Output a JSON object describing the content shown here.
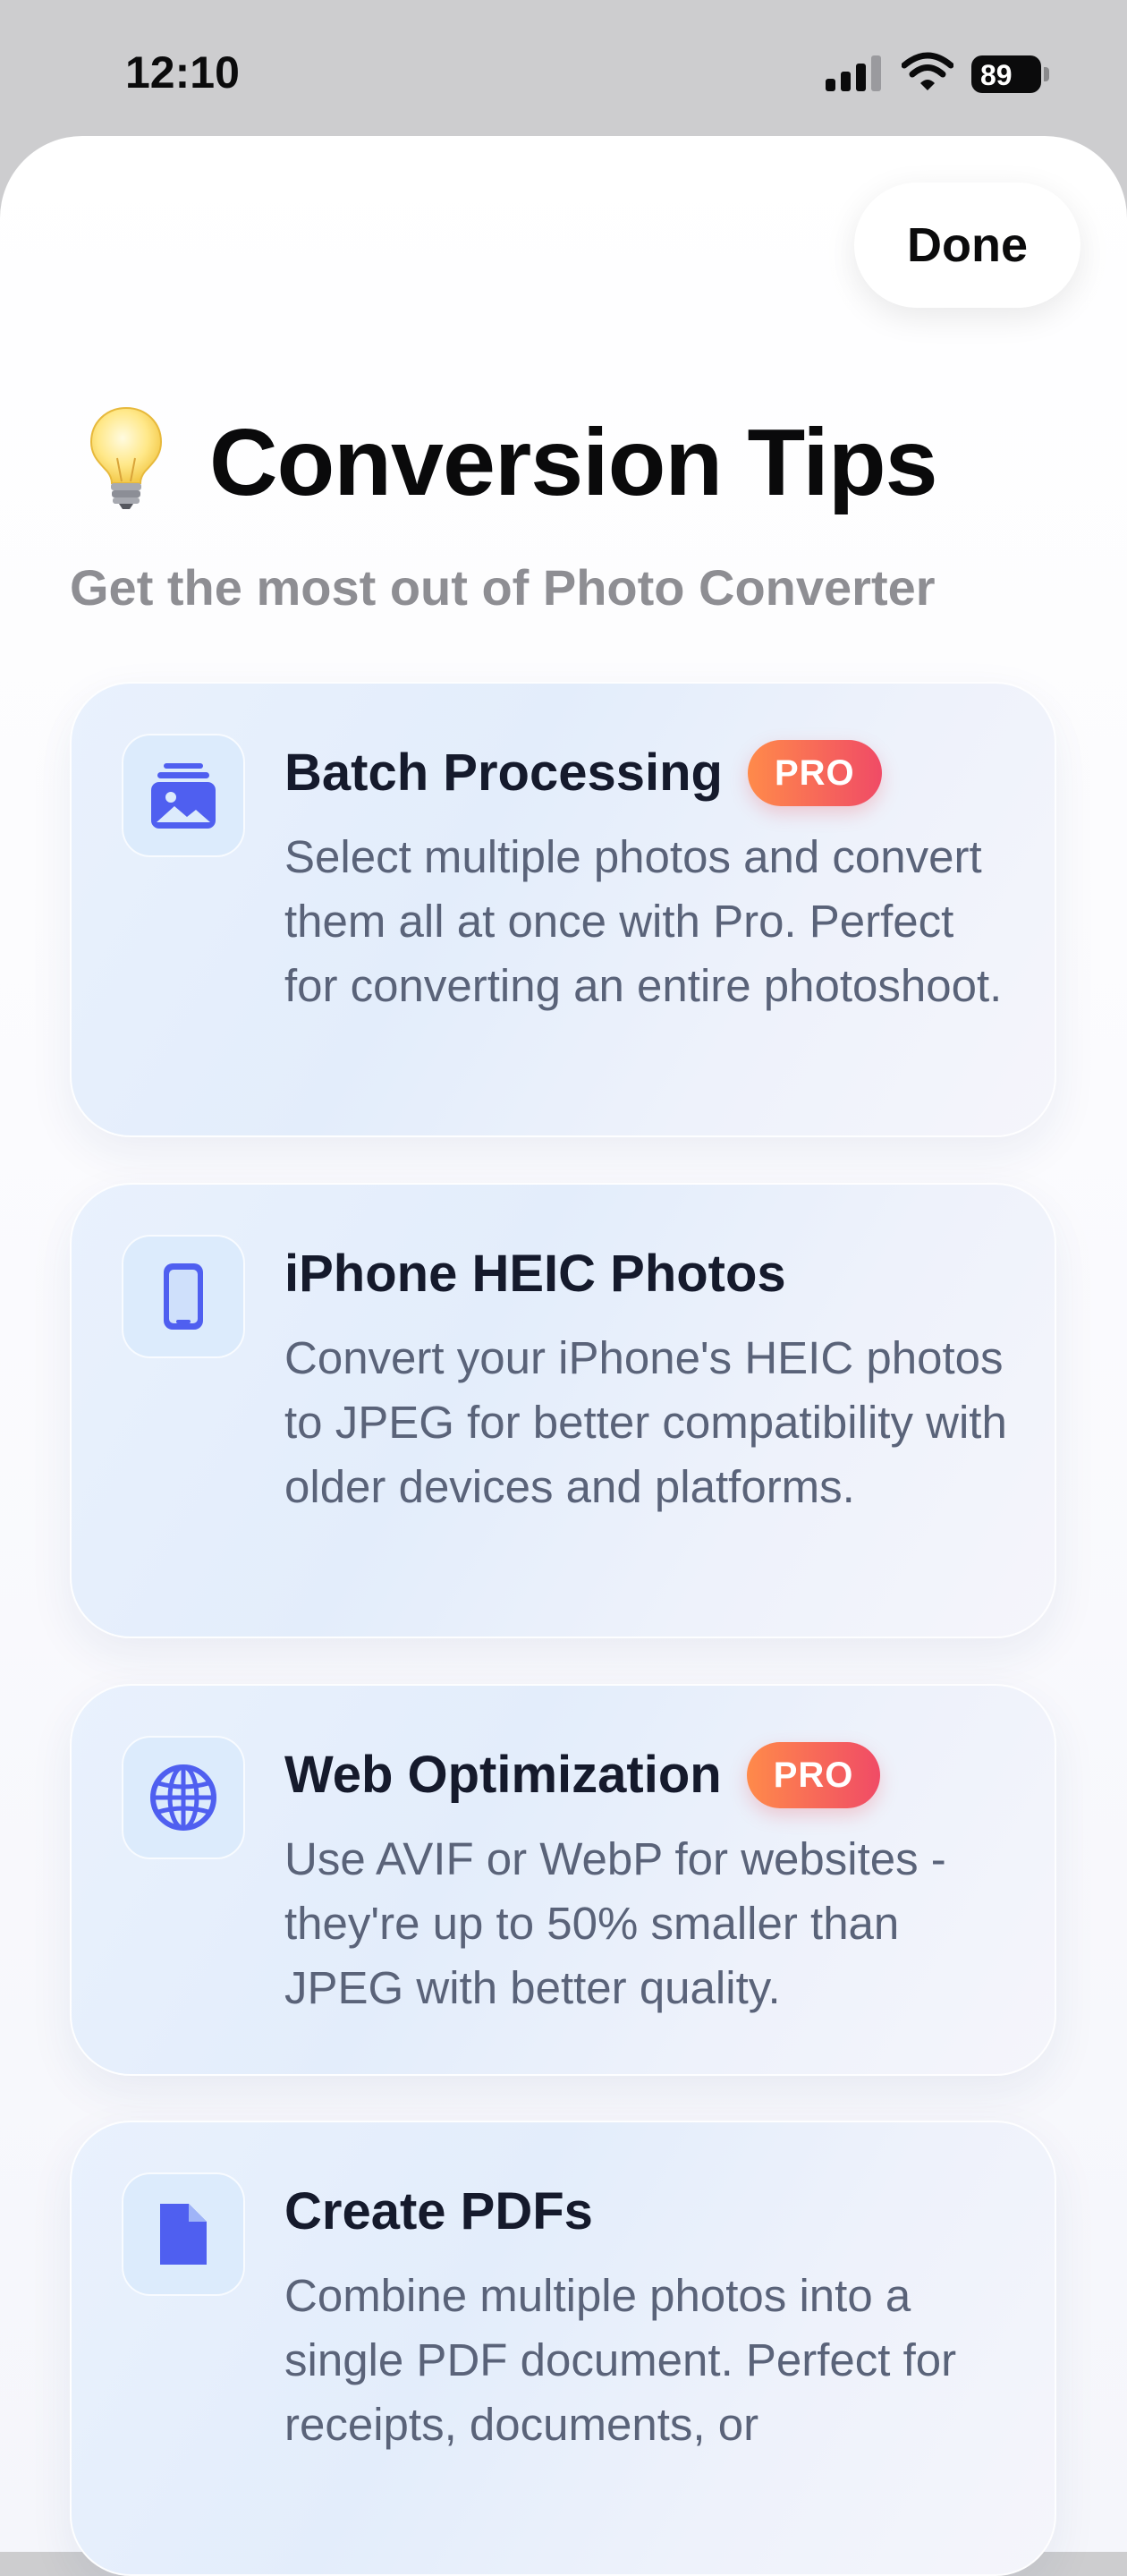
{
  "status_bar": {
    "time": "12:10",
    "battery": "89"
  },
  "sheet": {
    "done_label": "Done",
    "title": "Conversion Tips",
    "subtitle": "Get the most out of Photo Converter",
    "tips": [
      {
        "title": "Batch Processing",
        "badge": "PRO",
        "icon": "photo-stack-icon",
        "description": "Select multiple photos and convert them all at once with Pro. Perfect for converting an entire photoshoot."
      },
      {
        "title": "iPhone HEIC Photos",
        "badge": "",
        "icon": "iphone-icon",
        "description": "Convert your iPhone's HEIC photos to JPEG for better compatibility with older devices and platforms."
      },
      {
        "title": "Web Optimization",
        "badge": "PRO",
        "icon": "globe-icon",
        "description": "Use AVIF or WebP for websites - they're up to 50% smaller than JPEG with better quality."
      },
      {
        "title": "Create PDFs",
        "badge": "",
        "icon": "document-icon",
        "description": "Combine multiple photos into a single PDF document. Perfect for receipts, documents, or"
      }
    ]
  },
  "colors": {
    "accent": "#4f5ff0",
    "pro_badge_start": "#ff8a4a",
    "pro_badge_end": "#f04b66"
  }
}
